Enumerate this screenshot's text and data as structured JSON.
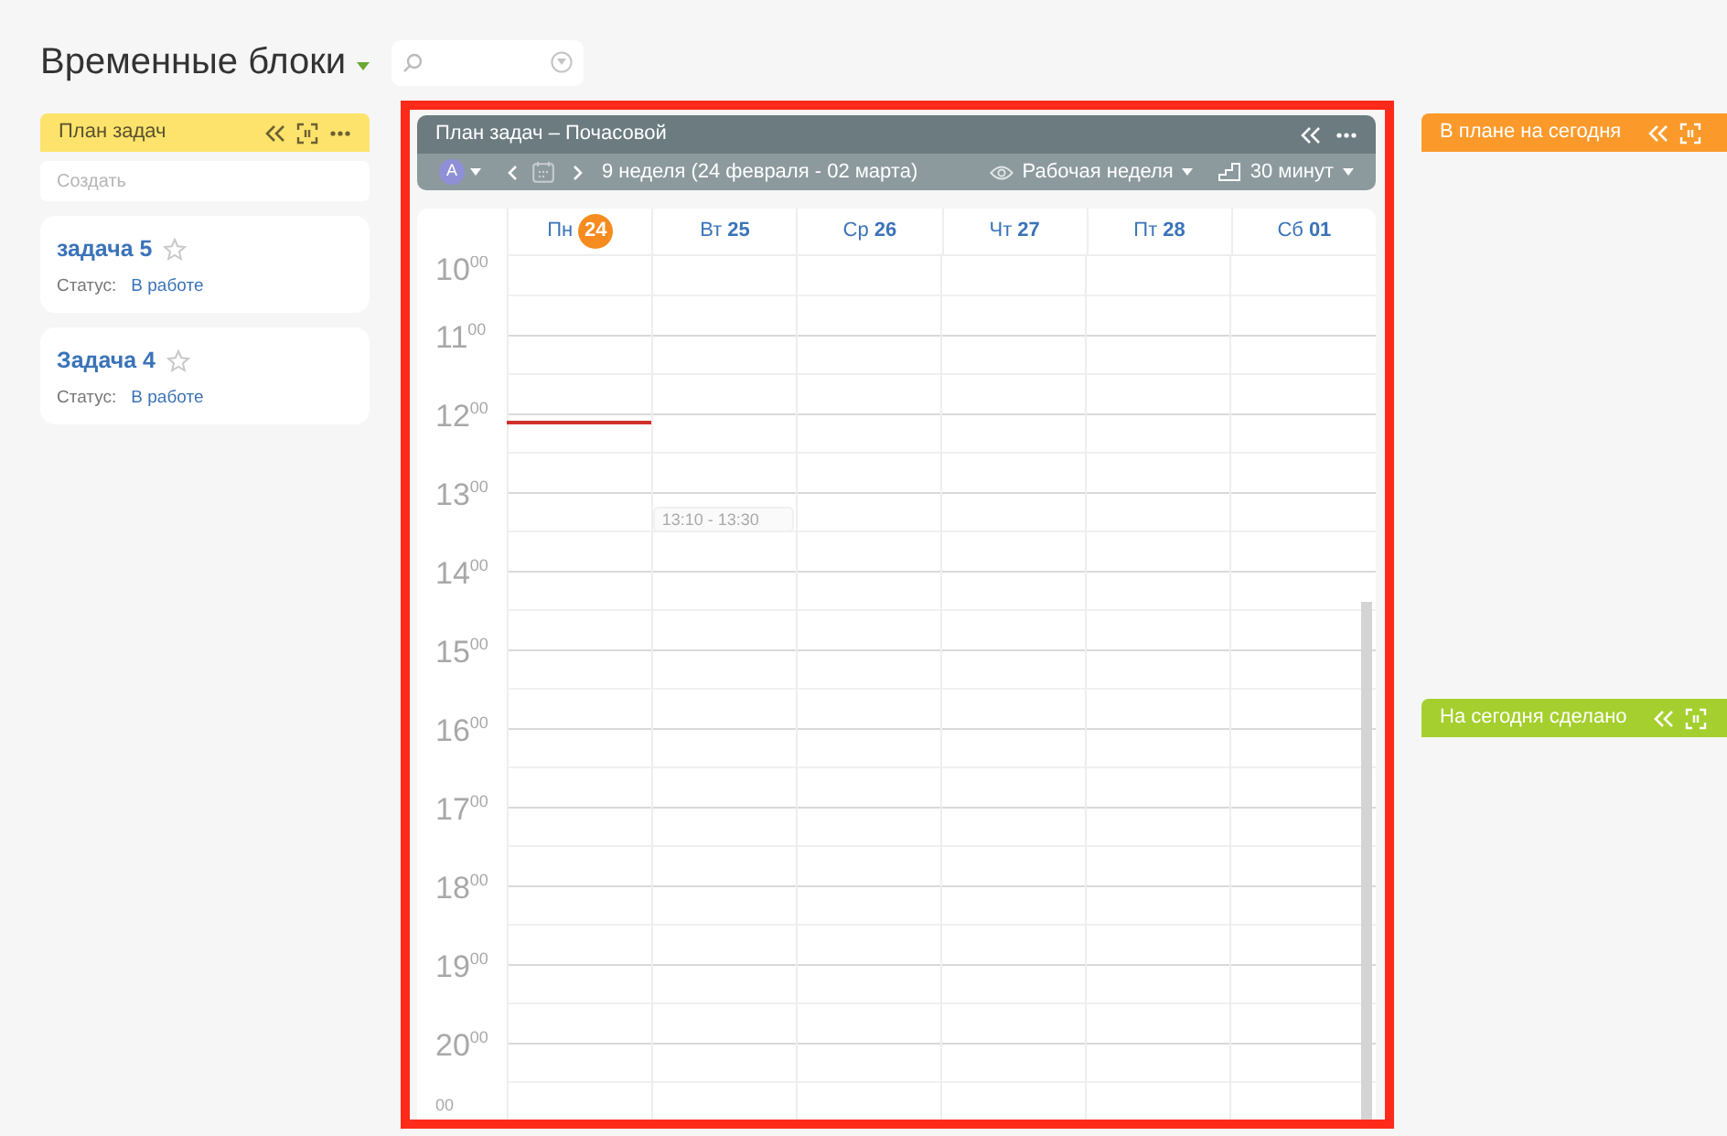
{
  "page_title": "Временные блоки",
  "task_column": {
    "title": "План задач",
    "color": "#fde36b",
    "create_placeholder": "Создать",
    "cards": [
      {
        "title": "задача 5",
        "starred": false,
        "status_label": "Статус:",
        "status": "В работе"
      },
      {
        "title": "Задача 4",
        "starred": false,
        "status_label": "Статус:",
        "status": "В работе"
      }
    ]
  },
  "calendar": {
    "title": "План задач – Почасовой",
    "user_initial": "A",
    "period": "9 неделя (24 февраля - 02 марта)",
    "view": "Рабочая неделя",
    "step": "30 минут",
    "days": [
      {
        "weekday": "Пн",
        "date": "24",
        "today": true,
        "now_line": true
      },
      {
        "weekday": "Вт",
        "date": "25",
        "today": false,
        "events": [
          {
            "time": "13:10 - 13:30"
          }
        ]
      },
      {
        "weekday": "Ср",
        "date": "26",
        "today": false
      },
      {
        "weekday": "Чт",
        "date": "27",
        "today": false
      },
      {
        "weekday": "Пт",
        "date": "28",
        "today": false
      },
      {
        "weekday": "Сб",
        "date": "01",
        "today": false
      }
    ],
    "hours": [
      {
        "hour": "10",
        "minutes": "00"
      },
      {
        "hour": "11",
        "minutes": "00"
      },
      {
        "hour": "12",
        "minutes": "00"
      },
      {
        "hour": "13",
        "minutes": "00"
      },
      {
        "hour": "14",
        "minutes": "00"
      },
      {
        "hour": "15",
        "minutes": "00"
      },
      {
        "hour": "16",
        "minutes": "00"
      },
      {
        "hour": "17",
        "minutes": "00"
      },
      {
        "hour": "18",
        "minutes": "00"
      },
      {
        "hour": "19",
        "minutes": "00"
      },
      {
        "hour": "20",
        "minutes": "00"
      },
      {
        "minutes": "00"
      }
    ]
  },
  "side_columns": [
    {
      "title": "В плане на сегодня",
      "color": "#fb9a2b"
    },
    {
      "title": "На сегодня сделано",
      "color": "#a5cf2e"
    }
  ]
}
